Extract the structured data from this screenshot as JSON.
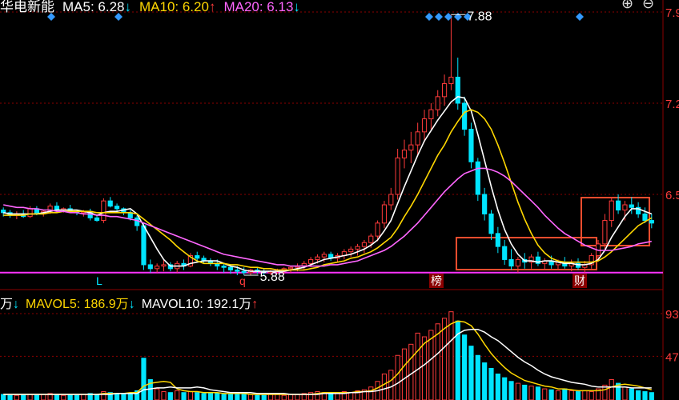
{
  "header": {
    "stock_name": "华电新能",
    "ma5": {
      "label": "MA5: 6.28",
      "arrow": "↓",
      "color": "#ffffff",
      "arrow_color": "#00e5ff"
    },
    "ma10": {
      "label": "MA10: 6.20",
      "arrow": "↑",
      "color": "#ffd700",
      "arrow_color": "#ff3b3b"
    },
    "ma20": {
      "label": "MA20: 6.13",
      "arrow": "↓",
      "color": "#ff66ff",
      "arrow_color": "#00e5ff"
    }
  },
  "controls": {
    "zoom_in": "⊕",
    "zoom_out": "⊖"
  },
  "volume_header": {
    "prefix": "万",
    "prefix_arrow": "↓",
    "mavol5": {
      "label": "MAVOL5: 186.9万",
      "arrow": "↓",
      "color": "#ffd700"
    },
    "mavol10": {
      "label": "MAVOL10: 192.1万",
      "arrow": "↑",
      "color": "#ffffff"
    }
  },
  "annotations": {
    "high": "7.88",
    "low": "5.88",
    "tag_bang": "榜",
    "tag_cai": "财",
    "tag_l": "L",
    "tag_q": "q"
  },
  "colors": {
    "up": "#ff3b3b",
    "down": "#00e5ff",
    "ma5": "#ffffff",
    "ma10": "#ffd700",
    "ma20": "#ff66ff",
    "grid": "#8b0000",
    "support": "#ff33ff",
    "box": "#ff4d2e",
    "marker": "#3399ff"
  },
  "chart_data": [
    {
      "type": "candlestick",
      "ylim": [
        5.8,
        7.95
      ],
      "yticks": [
        "7.9",
        "7.2",
        "6.5"
      ],
      "support_line": 5.9,
      "ohlc": [
        [
          6.38,
          6.4,
          6.33,
          6.36
        ],
        [
          6.36,
          6.38,
          6.32,
          6.34
        ],
        [
          6.34,
          6.37,
          6.31,
          6.35
        ],
        [
          6.35,
          6.38,
          6.32,
          6.33
        ],
        [
          6.33,
          6.41,
          6.32,
          6.39
        ],
        [
          6.39,
          6.41,
          6.34,
          6.35
        ],
        [
          6.35,
          6.38,
          6.33,
          6.37
        ],
        [
          6.37,
          6.43,
          6.35,
          6.41
        ],
        [
          6.41,
          6.44,
          6.37,
          6.38
        ],
        [
          6.38,
          6.4,
          6.36,
          6.39
        ],
        [
          6.39,
          6.42,
          6.36,
          6.37
        ],
        [
          6.37,
          6.38,
          6.34,
          6.36
        ],
        [
          6.36,
          6.38,
          6.33,
          6.37
        ],
        [
          6.37,
          6.39,
          6.3,
          6.32
        ],
        [
          6.32,
          6.34,
          6.29,
          6.3
        ],
        [
          6.3,
          6.47,
          6.28,
          6.45
        ],
        [
          6.45,
          6.48,
          6.4,
          6.41
        ],
        [
          6.41,
          6.43,
          6.36,
          6.39
        ],
        [
          6.39,
          6.4,
          6.34,
          6.36
        ],
        [
          6.36,
          6.38,
          6.3,
          6.32
        ],
        [
          6.32,
          6.34,
          6.22,
          6.26
        ],
        [
          6.26,
          6.28,
          5.92,
          5.96
        ],
        [
          5.96,
          6.0,
          5.9,
          5.93
        ],
        [
          5.93,
          5.97,
          5.9,
          5.95
        ],
        [
          5.95,
          6.0,
          5.91,
          5.96
        ],
        [
          5.96,
          5.98,
          5.91,
          5.93
        ],
        [
          5.93,
          5.99,
          5.9,
          5.97
        ],
        [
          5.97,
          6.0,
          5.92,
          5.95
        ],
        [
          5.95,
          6.05,
          5.94,
          6.03
        ],
        [
          6.03,
          6.06,
          5.99,
          6.01
        ],
        [
          6.01,
          6.03,
          5.97,
          5.99
        ],
        [
          5.99,
          6.01,
          5.95,
          5.97
        ],
        [
          5.97,
          6.0,
          5.92,
          5.95
        ],
        [
          5.95,
          5.97,
          5.9,
          5.94
        ],
        [
          5.94,
          5.96,
          5.89,
          5.92
        ],
        [
          5.92,
          5.95,
          5.88,
          5.91
        ],
        [
          5.91,
          5.94,
          5.88,
          5.9
        ],
        [
          5.9,
          5.93,
          5.88,
          5.92
        ],
        [
          5.92,
          5.94,
          5.89,
          5.91
        ],
        [
          5.91,
          5.93,
          5.88,
          5.9
        ],
        [
          5.9,
          5.92,
          5.88,
          5.91
        ],
        [
          5.91,
          5.93,
          5.89,
          5.92
        ],
        [
          5.92,
          5.94,
          5.89,
          5.93
        ],
        [
          5.93,
          5.95,
          5.9,
          5.94
        ],
        [
          5.94,
          5.97,
          5.91,
          5.95
        ],
        [
          5.95,
          5.99,
          5.92,
          5.97
        ],
        [
          5.97,
          6.02,
          5.94,
          6.0
        ],
        [
          6.0,
          6.04,
          5.97,
          6.02
        ],
        [
          6.02,
          6.06,
          5.98,
          6.04
        ],
        [
          6.04,
          6.06,
          5.99,
          6.01
        ],
        [
          6.01,
          6.05,
          5.98,
          6.03
        ],
        [
          6.03,
          6.08,
          6.0,
          6.06
        ],
        [
          6.06,
          6.1,
          6.02,
          6.08
        ],
        [
          6.08,
          6.12,
          6.03,
          6.1
        ],
        [
          6.1,
          6.15,
          6.05,
          6.13
        ],
        [
          6.13,
          6.2,
          6.09,
          6.18
        ],
        [
          6.18,
          6.3,
          6.14,
          6.28
        ],
        [
          6.28,
          6.45,
          6.24,
          6.42
        ],
        [
          6.42,
          6.55,
          6.38,
          6.5
        ],
        [
          6.5,
          6.85,
          6.46,
          6.78
        ],
        [
          6.78,
          6.92,
          6.7,
          6.84
        ],
        [
          6.84,
          6.98,
          6.74,
          6.88
        ],
        [
          6.88,
          7.05,
          6.8,
          6.98
        ],
        [
          6.98,
          7.15,
          6.9,
          7.08
        ],
        [
          7.08,
          7.2,
          7.0,
          7.15
        ],
        [
          7.15,
          7.3,
          7.1,
          7.25
        ],
        [
          7.25,
          7.42,
          7.18,
          7.35
        ],
        [
          7.35,
          7.88,
          7.3,
          7.4
        ],
        [
          7.4,
          7.55,
          7.15,
          7.2
        ],
        [
          7.2,
          7.25,
          6.95,
          7.0
        ],
        [
          7.0,
          7.05,
          6.7,
          6.75
        ],
        [
          6.75,
          6.78,
          6.45,
          6.5
        ],
        [
          6.5,
          6.55,
          6.3,
          6.35
        ],
        [
          6.35,
          6.38,
          6.15,
          6.2
        ],
        [
          6.2,
          6.25,
          6.05,
          6.1
        ],
        [
          6.1,
          6.15,
          5.96,
          6.0
        ],
        [
          6.0,
          6.08,
          5.92,
          5.95
        ],
        [
          5.95,
          6.02,
          5.9,
          6.0
        ],
        [
          6.0,
          6.05,
          5.93,
          5.98
        ],
        [
          5.98,
          6.04,
          5.93,
          6.02
        ],
        [
          6.02,
          6.06,
          5.95,
          5.97
        ],
        [
          5.97,
          6.01,
          5.92,
          5.99
        ],
        [
          5.99,
          6.03,
          5.93,
          5.96
        ],
        [
          5.96,
          6.0,
          5.92,
          5.98
        ],
        [
          5.98,
          6.02,
          5.93,
          5.95
        ],
        [
          5.95,
          6.0,
          5.91,
          5.97
        ],
        [
          5.97,
          6.01,
          5.92,
          5.94
        ],
        [
          5.94,
          5.99,
          5.9,
          5.96
        ],
        [
          5.96,
          6.05,
          5.93,
          6.03
        ],
        [
          6.03,
          6.15,
          6.0,
          6.12
        ],
        [
          6.12,
          6.35,
          6.08,
          6.3
        ],
        [
          6.3,
          6.48,
          6.25,
          6.45
        ],
        [
          6.45,
          6.5,
          6.35,
          6.38
        ],
        [
          6.38,
          6.45,
          6.3,
          6.42
        ],
        [
          6.42,
          6.48,
          6.35,
          6.4
        ],
        [
          6.4,
          6.44,
          6.32,
          6.35
        ],
        [
          6.35,
          6.4,
          6.28,
          6.3
        ],
        [
          6.3,
          6.35,
          6.24,
          6.28
        ]
      ],
      "series": [
        {
          "name": "MA5",
          "color": "#ffffff",
          "values": [
            6.36,
            6.35,
            6.35,
            6.35,
            6.35,
            6.35,
            6.36,
            6.37,
            6.38,
            6.38,
            6.38,
            6.38,
            6.37,
            6.36,
            6.34,
            6.36,
            6.37,
            6.37,
            6.38,
            6.39,
            6.35,
            6.26,
            6.17,
            6.08,
            6.0,
            5.95,
            5.95,
            5.95,
            5.97,
            5.98,
            5.99,
            5.99,
            5.99,
            5.97,
            5.95,
            5.94,
            5.92,
            5.91,
            5.91,
            5.91,
            5.91,
            5.91,
            5.91,
            5.92,
            5.93,
            5.94,
            5.96,
            5.98,
            6.0,
            6.01,
            6.02,
            6.03,
            6.04,
            6.06,
            6.08,
            6.11,
            6.15,
            6.22,
            6.3,
            6.43,
            6.56,
            6.68,
            6.8,
            6.91,
            6.99,
            7.07,
            7.14,
            7.21,
            7.25,
            7.24,
            7.14,
            6.96,
            6.76,
            6.56,
            6.38,
            6.23,
            6.12,
            6.04,
            5.99,
            5.99,
            5.98,
            5.99,
            5.99,
            5.98,
            5.97,
            5.97,
            5.96,
            5.96,
            5.97,
            6.0,
            6.07,
            6.17,
            6.25,
            6.33,
            6.39,
            6.39,
            6.37,
            6.35
          ]
        },
        {
          "name": "MA10",
          "color": "#ffd700",
          "values": [
            6.34,
            6.34,
            6.34,
            6.34,
            6.35,
            6.35,
            6.35,
            6.36,
            6.36,
            6.37,
            6.37,
            6.37,
            6.37,
            6.37,
            6.36,
            6.36,
            6.36,
            6.36,
            6.36,
            6.36,
            6.35,
            6.31,
            6.27,
            6.23,
            6.19,
            6.15,
            6.1,
            6.06,
            6.02,
            5.99,
            5.97,
            5.97,
            5.97,
            5.97,
            5.96,
            5.96,
            5.95,
            5.94,
            5.94,
            5.93,
            5.93,
            5.92,
            5.92,
            5.92,
            5.92,
            5.92,
            5.93,
            5.94,
            5.96,
            5.97,
            5.98,
            5.99,
            6.01,
            6.02,
            6.04,
            6.06,
            6.09,
            6.13,
            6.17,
            6.24,
            6.33,
            6.41,
            6.5,
            6.6,
            6.7,
            6.8,
            6.88,
            6.98,
            7.06,
            7.13,
            7.15,
            7.13,
            7.08,
            7.0,
            6.88,
            6.74,
            6.59,
            6.44,
            6.31,
            6.2,
            6.11,
            6.05,
            6.01,
            5.99,
            5.98,
            5.98,
            5.98,
            5.98,
            5.98,
            5.99,
            6.02,
            6.06,
            6.11,
            6.16,
            6.21,
            6.26,
            6.29,
            6.32
          ]
        },
        {
          "name": "MA20",
          "color": "#ff66ff",
          "values": [
            6.42,
            6.41,
            6.4,
            6.4,
            6.39,
            6.39,
            6.38,
            6.38,
            6.37,
            6.37,
            6.36,
            6.36,
            6.35,
            6.35,
            6.34,
            6.34,
            6.33,
            6.33,
            6.32,
            6.31,
            6.3,
            6.28,
            6.26,
            6.24,
            6.22,
            6.2,
            6.18,
            6.16,
            6.14,
            6.12,
            6.1,
            6.08,
            6.06,
            6.04,
            6.03,
            6.02,
            6.01,
            6.0,
            5.99,
            5.98,
            5.97,
            5.96,
            5.96,
            5.95,
            5.95,
            5.95,
            5.95,
            5.95,
            5.95,
            5.96,
            5.96,
            5.97,
            5.98,
            5.99,
            6.01,
            6.03,
            6.05,
            6.07,
            6.1,
            6.14,
            6.18,
            6.23,
            6.28,
            6.34,
            6.4,
            6.46,
            6.52,
            6.57,
            6.62,
            6.66,
            6.68,
            6.7,
            6.7,
            6.69,
            6.67,
            6.64,
            6.6,
            6.55,
            6.5,
            6.45,
            6.4,
            6.34,
            6.29,
            6.24,
            6.2,
            6.17,
            6.14,
            6.11,
            6.09,
            6.07,
            6.07,
            6.07,
            6.08,
            6.09,
            6.1,
            6.12,
            6.13,
            6.14
          ]
        }
      ]
    },
    {
      "type": "bar",
      "ylim": [
        0,
        100
      ],
      "yticks": [
        "93",
        "47"
      ],
      "volumes": [
        6,
        5,
        5,
        6,
        6,
        5,
        6,
        7,
        6,
        5,
        6,
        5,
        6,
        7,
        6,
        9,
        8,
        7,
        6,
        7,
        10,
        45,
        22,
        12,
        9,
        8,
        10,
        8,
        9,
        8,
        7,
        8,
        7,
        6,
        6,
        7,
        6,
        6,
        5,
        5,
        6,
        6,
        5,
        6,
        6,
        7,
        8,
        9,
        8,
        7,
        8,
        9,
        8,
        10,
        11,
        14,
        20,
        28,
        32,
        48,
        55,
        60,
        72,
        68,
        75,
        82,
        88,
        95,
        85,
        70,
        58,
        48,
        40,
        34,
        28,
        24,
        20,
        18,
        16,
        15,
        14,
        12,
        11,
        10,
        12,
        10,
        9,
        10,
        9,
        12,
        16,
        22,
        18,
        14,
        12,
        10,
        9,
        8
      ],
      "series": [
        {
          "name": "MAVOL5",
          "color": "#ffd700",
          "values": [
            6,
            6,
            6,
            6,
            6,
            6,
            6,
            6,
            6,
            6,
            6,
            6,
            6,
            6,
            6,
            7,
            7,
            7,
            7,
            8,
            8,
            15,
            18,
            19,
            20,
            19,
            12,
            10,
            9,
            9,
            8,
            8,
            8,
            7,
            7,
            7,
            7,
            6,
            6,
            6,
            6,
            6,
            6,
            6,
            6,
            6,
            6,
            7,
            8,
            8,
            8,
            8,
            8,
            9,
            9,
            10,
            13,
            17,
            21,
            28,
            37,
            45,
            53,
            61,
            66,
            71,
            77,
            82,
            85,
            84,
            80,
            71,
            60,
            50,
            42,
            35,
            29,
            25,
            21,
            19,
            17,
            15,
            14,
            12,
            12,
            11,
            10,
            10,
            10,
            10,
            11,
            14,
            16,
            17,
            16,
            15,
            13,
            11
          ]
        },
        {
          "name": "MAVOL10",
          "color": "#ffffff",
          "values": [
            6,
            6,
            6,
            6,
            6,
            6,
            6,
            6,
            6,
            6,
            6,
            6,
            6,
            6,
            6,
            6,
            6,
            7,
            7,
            7,
            7,
            11,
            12,
            13,
            13,
            14,
            13,
            13,
            13,
            14,
            13,
            11,
            10,
            9,
            8,
            8,
            8,
            8,
            7,
            7,
            7,
            7,
            7,
            6,
            6,
            6,
            6,
            6,
            7,
            7,
            7,
            7,
            8,
            8,
            9,
            9,
            10,
            12,
            14,
            18,
            23,
            28,
            33,
            38,
            44,
            50,
            57,
            64,
            71,
            75,
            76,
            76,
            73,
            68,
            64,
            58,
            52,
            46,
            41,
            37,
            32,
            28,
            25,
            23,
            21,
            19,
            18,
            17,
            15,
            14,
            14,
            14,
            14,
            14,
            13,
            13,
            13,
            13
          ]
        }
      ]
    }
  ]
}
